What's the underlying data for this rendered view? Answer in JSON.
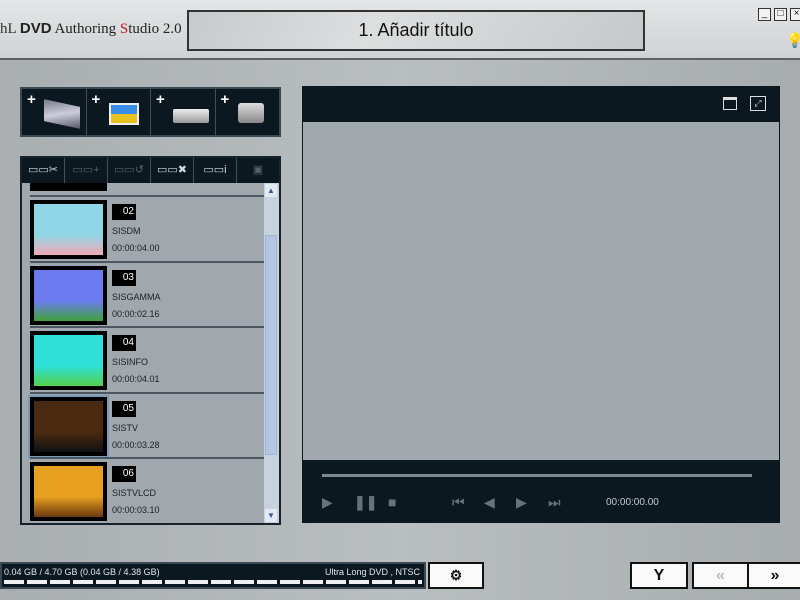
{
  "app": {
    "logo_prefix": "hL",
    "logo_dvd": "DVD",
    "logo_text1": "Authoring ",
    "logo_s": "S",
    "logo_text2": "tudio 2.0",
    "step_title": "1. Añadir título"
  },
  "window": {
    "minimize": "_",
    "restore": "□",
    "close": "×"
  },
  "add_toolbar": [
    {
      "label": "+",
      "icon": "film-reel-icon"
    },
    {
      "label": "+",
      "icon": "photos-icon"
    },
    {
      "label": "+",
      "icon": "disc-drive-icon"
    },
    {
      "label": "+",
      "icon": "camcorder-icon"
    }
  ],
  "list_toolbar": [
    {
      "glyph": "▭▭✂",
      "name": "split-clip-icon",
      "enabled": true
    },
    {
      "glyph": "▭▭+",
      "name": "merge-clip-icon",
      "enabled": false
    },
    {
      "glyph": "▭▭↺",
      "name": "rotate-clip-icon",
      "enabled": false
    },
    {
      "glyph": "▭▭✖",
      "name": "delete-clip-icon",
      "enabled": true
    },
    {
      "glyph": "▭▭i",
      "name": "clip-info-icon",
      "enabled": true
    },
    {
      "glyph": "▣",
      "name": "effects-icon",
      "enabled": false
    }
  ],
  "titles": [
    {
      "num": "02",
      "name": "SISDM",
      "duration": "00:00:04.00",
      "colors": [
        "#8fd7e6",
        "#f1a9b5"
      ]
    },
    {
      "num": "03",
      "name": "SISGAMMA",
      "duration": "00:00:02.16",
      "colors": [
        "#6c7cf0",
        "#3fa23a"
      ]
    },
    {
      "num": "04",
      "name": "SISINFO",
      "duration": "00:00:04.01",
      "colors": [
        "#2fe0d8",
        "#52d04a"
      ]
    },
    {
      "num": "05",
      "name": "SISTV",
      "duration": "00:00:03.28",
      "colors": [
        "#4a2a10",
        "#111"
      ]
    },
    {
      "num": "06",
      "name": "SISTVLCD",
      "duration": "00:00:03.10",
      "colors": [
        "#e8a020",
        "#6a3a10"
      ]
    }
  ],
  "player": {
    "time": "00:00:00.00",
    "progress": 0
  },
  "status": {
    "usage": "0.04 GB / 4.70 GB (0.04 GB / 4.38 GB)",
    "format": "Ultra Long DVD , NTSC",
    "fill_fraction": 0.01
  },
  "nav": {
    "prev": "«",
    "next": "»",
    "tools": "Y"
  }
}
